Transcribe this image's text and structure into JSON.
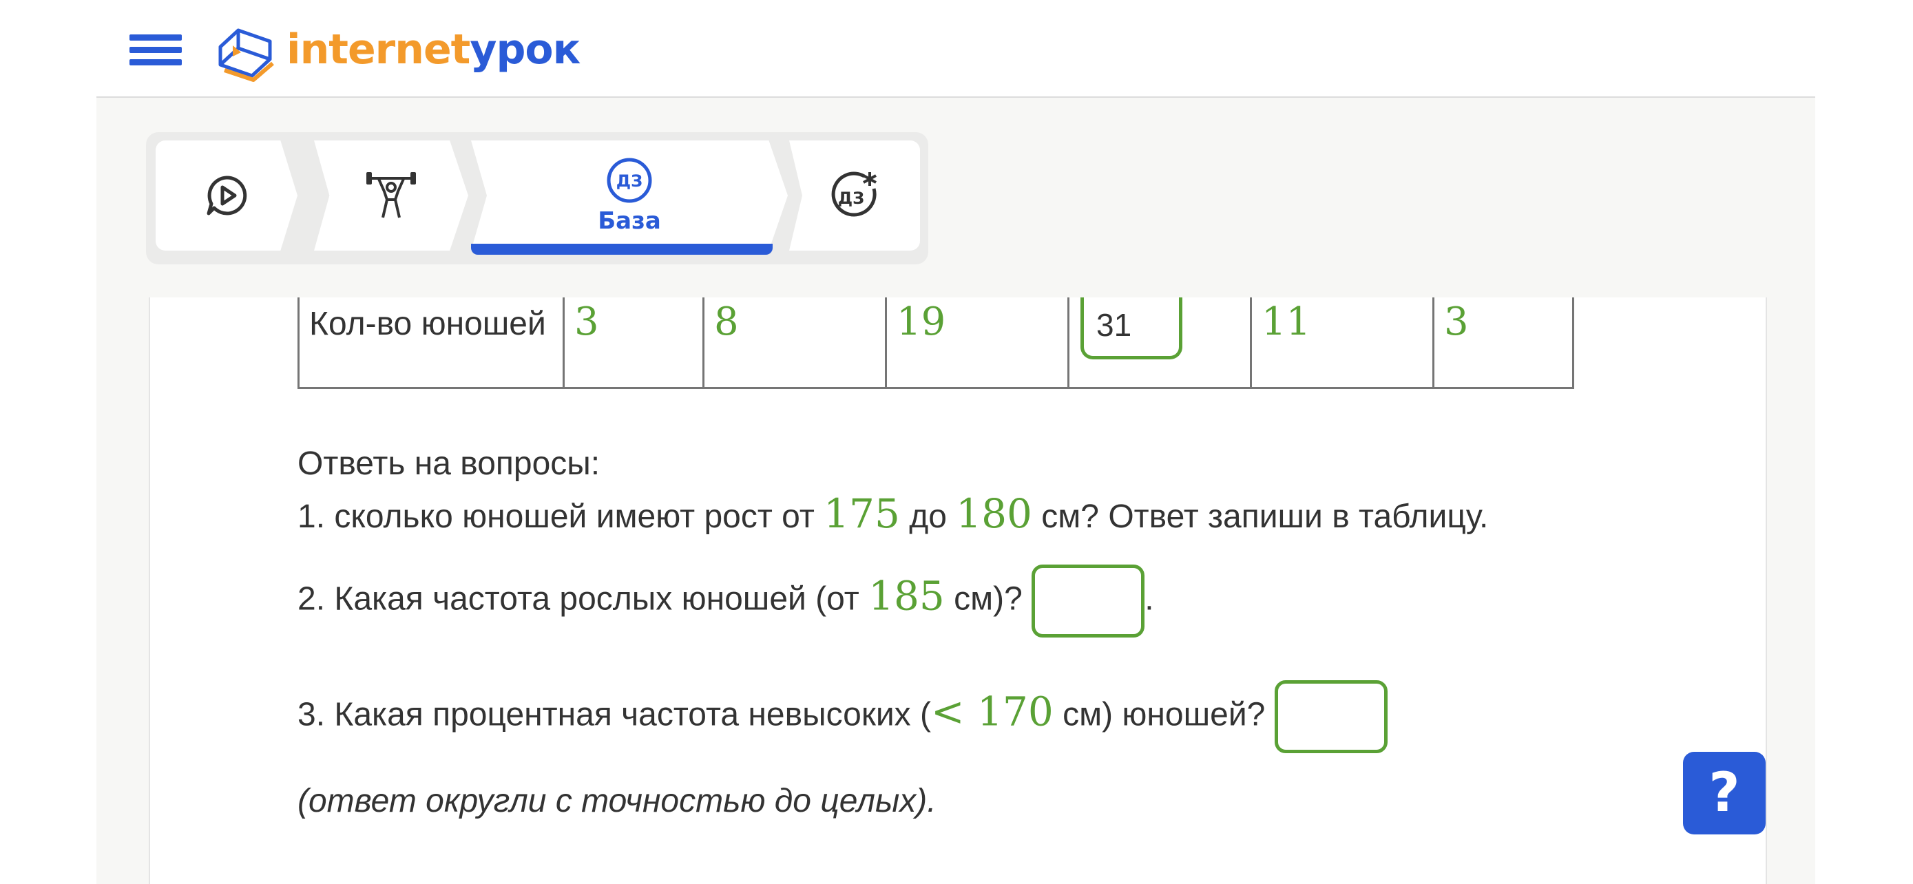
{
  "header": {
    "logo_part1": "internet",
    "logo_part2": "урок"
  },
  "tabs": [
    {
      "icon": "video-chat-icon",
      "label": ""
    },
    {
      "icon": "weightlifter-icon",
      "label": ""
    },
    {
      "icon": "homework-badge-icon",
      "badge": "ДЗ",
      "label": "База",
      "active": true
    },
    {
      "icon": "homework-star-icon",
      "badge": "ДЗ",
      "label": ""
    }
  ],
  "table": {
    "row_label": "Кол-во юношей",
    "values": [
      "3",
      "8",
      "19",
      "31",
      "11",
      "3"
    ],
    "input_index": 3
  },
  "questions": {
    "intro": "Ответь на вопросы:",
    "q1_a": "1. сколько юношей имеют рост от ",
    "q1_n1": "175",
    "q1_b": " до ",
    "q1_n2": "180",
    "q1_c": " см? Ответ запиши в таблицу.",
    "q2_a": "2. Какая частота рослых юношей (от ",
    "q2_n": "185",
    "q2_b": " см)? ",
    "q2_c": ".",
    "q3_a": "3. Какая процентная частота невысоких (",
    "q3_n": "< 170",
    "q3_b": " см) юношей? ",
    "note": "(ответ округли с точностью до целых)."
  },
  "help_label": "?",
  "colors": {
    "brand_blue": "#2a5bd7",
    "brand_orange": "#f39a2b",
    "answer_green": "#5aa135"
  }
}
